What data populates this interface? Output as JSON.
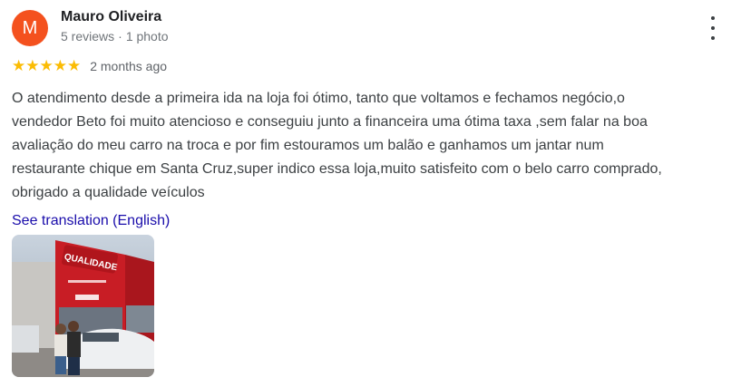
{
  "reviewer": {
    "initial": "M",
    "name": "Mauro Oliveira",
    "reviews": "5 reviews",
    "photos": "1 photo",
    "separator": "·",
    "avatar_color": "#f4511e"
  },
  "rating": {
    "stars": 5,
    "stars_display": "★★★★★",
    "time": "2 months ago",
    "star_color": "#fbbc04"
  },
  "review": {
    "lines": [
      "O atendimento desde a primeira ida na loja foi ótimo, tanto que voltamos e fechamos negócio,o",
      "vendedor Beto foi muito atencioso e conseguiu junto a financeira uma ótima taxa ,sem falar na boa",
      "avaliação do meu carro na troca e por fim estouramos um balão e ganhamos um jantar num",
      "restaurante chique em Santa Cruz,super indico essa loja,muito satisfeito com o belo carro comprado,",
      "obrigado a qualidade veículos"
    ],
    "translate_link": "See translation (English)"
  },
  "photo": {
    "sign_text": "QUALIDADE",
    "icon": "storefront-photo"
  },
  "colors": {
    "link": "#1a0dab",
    "text": "#3c4043"
  }
}
